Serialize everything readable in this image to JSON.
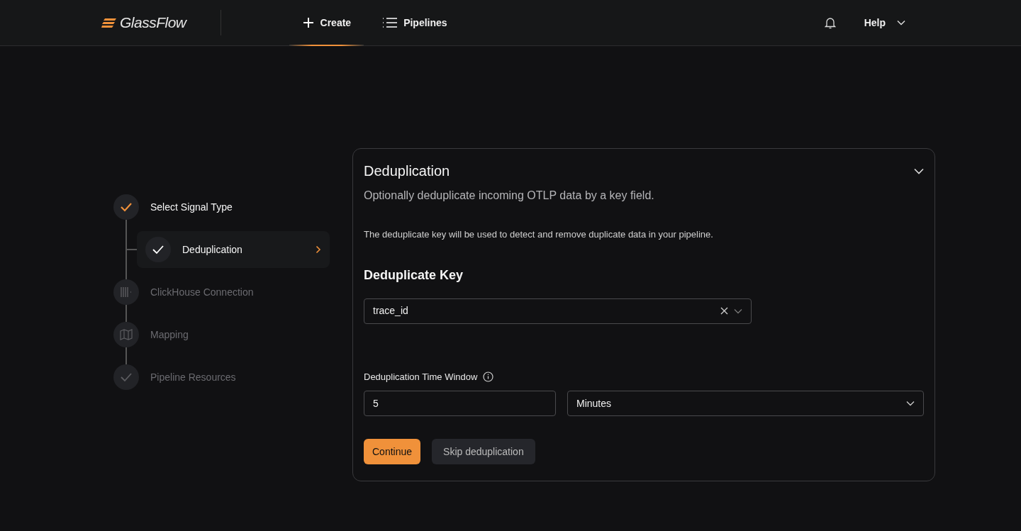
{
  "navbar": {
    "logo": "GlassFlow",
    "links": [
      {
        "label": "Create",
        "kind": "create",
        "selected": true
      },
      {
        "label": "Pipelines",
        "kind": "list",
        "selected": false
      }
    ],
    "help": "Help"
  },
  "steps": [
    {
      "label": "Select Signal Type",
      "kind": "check",
      "completed": true,
      "disabled": false,
      "children": [
        {
          "label": "Deduplication",
          "kind": "check",
          "completed": false,
          "disabled": false,
          "selected": true
        }
      ]
    },
    {
      "label": "ClickHouse Connection",
      "kind": "connection",
      "completed": false,
      "disabled": true
    },
    {
      "label": "Mapping",
      "kind": "mapping",
      "completed": false,
      "disabled": true
    },
    {
      "label": "Pipeline Resources",
      "kind": "check",
      "completed": false,
      "disabled": true
    }
  ],
  "panel": {
    "title": "Deduplication",
    "expanded": true,
    "subtitle": "Optionally deduplicate incoming OTLP data by a key field.",
    "description": "The deduplicate key will be used to detect and remove duplicate data in your pipeline.",
    "key_heading": "Deduplicate Key",
    "key_value": "trace_id",
    "window_label": "Deduplication Time Window",
    "window_value": "5",
    "window_unit": "Minutes",
    "buttons": [
      {
        "label": "Continue",
        "kind": "primary"
      },
      {
        "label": "Skip deduplication",
        "kind": "secondary"
      }
    ]
  }
}
